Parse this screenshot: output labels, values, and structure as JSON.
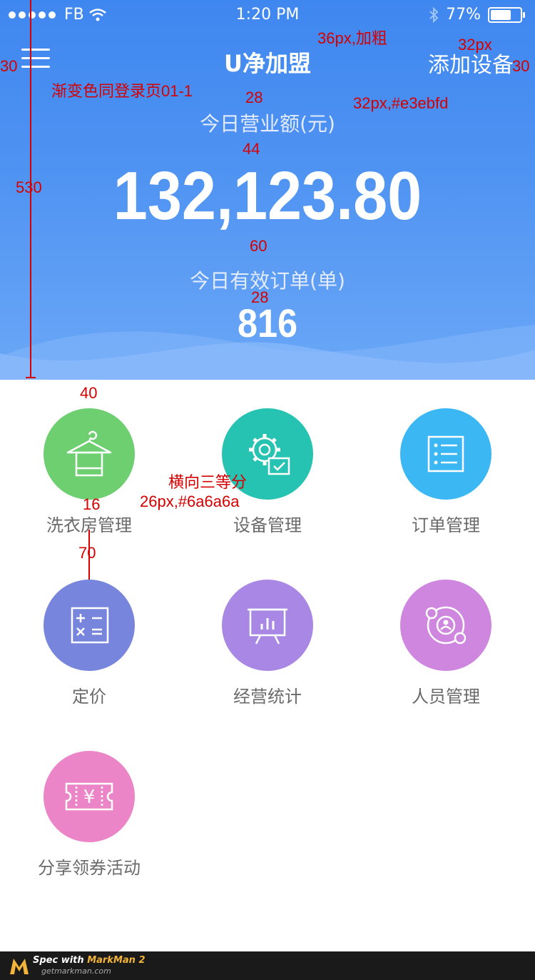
{
  "status": {
    "carrier": "FB",
    "time": "1:20 PM",
    "battery": "77%",
    "battery_level": 0.77
  },
  "nav": {
    "title": "U净加盟",
    "add_label": "添加设备"
  },
  "stats": {
    "revenue_label": "今日营业额(元)",
    "revenue_value": "132,123.80",
    "orders_label": "今日有效订单(单)",
    "orders_value": "816"
  },
  "menu": [
    {
      "label": "洗衣房管理",
      "color": "#6ecf71",
      "icon": "hanger-icon"
    },
    {
      "label": "设备管理",
      "color": "#27c3b2",
      "icon": "gear-device-icon"
    },
    {
      "label": "订单管理",
      "color": "#3bb7f3",
      "icon": "order-list-icon"
    },
    {
      "label": "定价",
      "color": "#7785dc",
      "icon": "calculator-icon"
    },
    {
      "label": "经营统计",
      "color": "#a888e4",
      "icon": "stats-board-icon"
    },
    {
      "label": "人员管理",
      "color": "#cf86df",
      "icon": "people-icon"
    },
    {
      "label": "分享领券活动",
      "color": "#ec85c8",
      "icon": "coupon-icon"
    }
  ],
  "annotations": {
    "a30l": "30",
    "a36": "36px,加粗",
    "a32": "32px",
    "a30r": "30",
    "grad": "渐变色同登录页01-1",
    "a28a": "28",
    "a32c": "32px,#e3ebfd",
    "a44": "44",
    "a530": "530",
    "a60": "60",
    "a28b": "28",
    "a40": "40",
    "a3eq": "横向三等分",
    "a16": "16",
    "a26": "26px,#6a6a6a",
    "a70": "70"
  },
  "footer": {
    "line1_prefix": "Spec with ",
    "line1_brand": "MarkMan 2",
    "line2": "getmarkman.com"
  }
}
